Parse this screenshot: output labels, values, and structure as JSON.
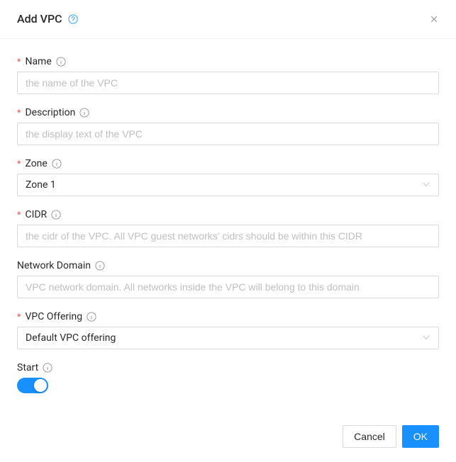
{
  "header": {
    "title": "Add VPC"
  },
  "form": {
    "name": {
      "label": "Name",
      "required": true,
      "placeholder": "the name of the VPC",
      "value": ""
    },
    "description": {
      "label": "Description",
      "required": true,
      "placeholder": "the display text of the VPC",
      "value": ""
    },
    "zone": {
      "label": "Zone",
      "required": true,
      "value": "Zone 1"
    },
    "cidr": {
      "label": "CIDR",
      "required": true,
      "placeholder": "the cidr of the VPC. All VPC guest networks' cidrs should be within this CIDR",
      "value": ""
    },
    "networkDomain": {
      "label": "Network Domain",
      "required": false,
      "placeholder": "VPC network domain. All networks inside the VPC will belong to this domain",
      "value": ""
    },
    "vpcOffering": {
      "label": "VPC Offering",
      "required": true,
      "value": "Default VPC offering"
    },
    "start": {
      "label": "Start",
      "required": false,
      "value": true
    }
  },
  "footer": {
    "cancel": "Cancel",
    "ok": "OK"
  }
}
